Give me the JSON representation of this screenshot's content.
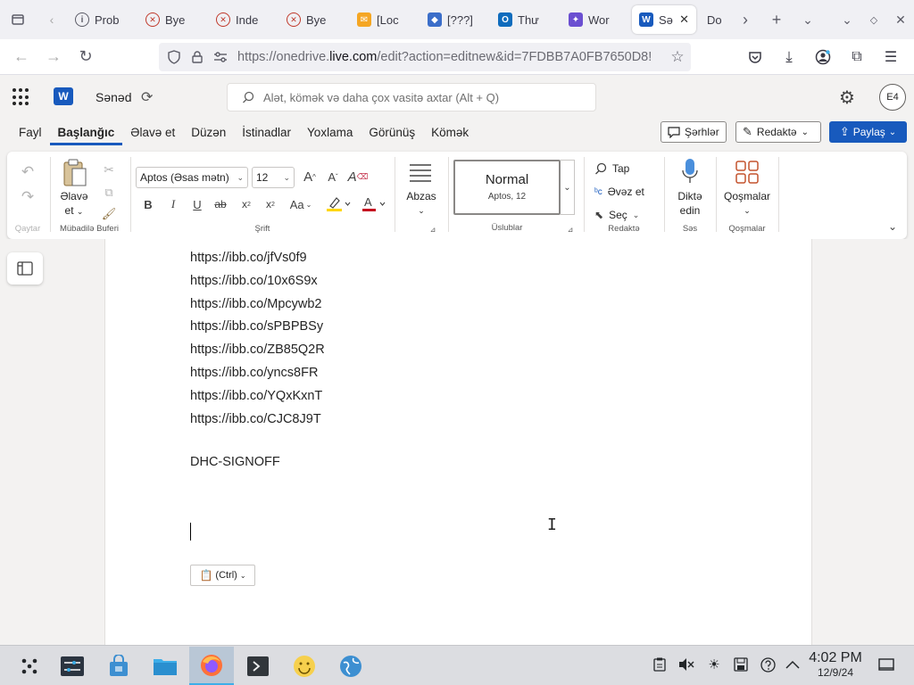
{
  "browser": {
    "tabs": [
      {
        "label": "Prob",
        "icon": "info-icon",
        "color": "#5b5b66"
      },
      {
        "label": "Bye",
        "icon": "x-circle-icon",
        "color": "#c0392b"
      },
      {
        "label": "Inde",
        "icon": "x-circle-icon",
        "color": "#c0392b"
      },
      {
        "label": "Bye",
        "icon": "x-circle-icon",
        "color": "#c0392b"
      },
      {
        "label": "[Loc",
        "icon": "mail-icon",
        "color": "#f5a623"
      },
      {
        "label": "[???]",
        "icon": "vpn-icon",
        "color": "#3b6ec9"
      },
      {
        "label": "Thư",
        "icon": "outlook-icon",
        "color": "#0f6cbd"
      },
      {
        "label": "Wor",
        "icon": "copilot-icon",
        "color": "#6b4fd1"
      },
      {
        "label": "Sə",
        "icon": "word-icon",
        "color": "#185abd",
        "active": true
      },
      {
        "label": "Do",
        "icon": "",
        "color": ""
      }
    ],
    "url_prefix": "https://onedrive.",
    "url_host": "live.com",
    "url_rest": "/edit?action=editnew&id=7FDBB7A0FB7650D8!"
  },
  "app": {
    "logo_letter": "W",
    "doc_title": "Sənəd",
    "search_placeholder": "Alət, kömək və daha çox vasitə axtar (Alt + Q)",
    "avatar_initials": "E4"
  },
  "menu": {
    "tabs": [
      "Fayl",
      "Başlanğıc",
      "Əlavə et",
      "Düzən",
      "İstinadlar",
      "Yoxlama",
      "Görünüş",
      "Kömək"
    ],
    "active_tab": "Başlanğıc",
    "comments_label": "Şərhlər",
    "editing_label": "Redaktə",
    "share_label": "Paylaş"
  },
  "ribbon": {
    "undo_group": "Qaytar",
    "paste_label_1": "Əlavə",
    "paste_label_2": "et",
    "clipboard_group": "Mübadilə Buferi",
    "font_name": "Aptos (Əsas mətn)",
    "font_size": "12",
    "font_group": "Şrift",
    "paragraph_label": "Abzas",
    "style_name": "Normal",
    "style_font": "Aptos, 12",
    "styles_group": "Üslublar",
    "find_label": "Tap",
    "replace_label": "Əvəz et",
    "select_label": "Seç",
    "editing_group": "Redaktə",
    "dictate_label_1": "Diktə",
    "dictate_label_2": "edin",
    "voice_group": "Səs",
    "addins_label": "Qoşmalar",
    "addins_group": "Qoşmalar",
    "font_color": "#c50f1f",
    "highlight_color": "#ffd600"
  },
  "document": {
    "lines": [
      "https://ibb.co/jfVs0f9",
      "https://ibb.co/10x6S9x",
      "https://ibb.co/Mpcywb2",
      "https://ibb.co/sPBPBSy",
      "https://ibb.co/ZB85Q2R",
      "https://ibb.co/yncs8FR",
      "https://ibb.co/YQxKxnT",
      "https://ibb.co/CJC8J9T"
    ],
    "signoff": "DHC-SIGNOFF",
    "paste_options_label": "(Ctrl)"
  },
  "taskbar": {
    "time": "4:02 PM",
    "date": "12/9/24"
  }
}
